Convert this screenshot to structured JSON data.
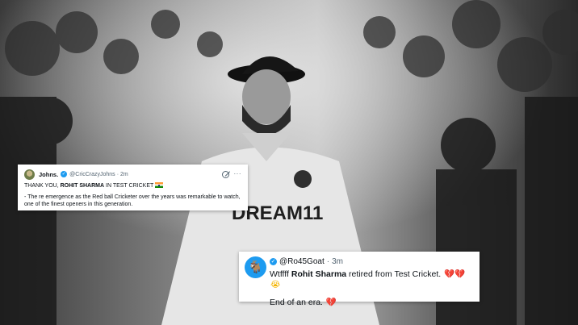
{
  "tweet_top": {
    "name": "Johns.",
    "handle": "@CricCrazyJohns",
    "separator": "·",
    "time": "2m",
    "more_icon": "more-horizontal-icon",
    "lead": "THANK YOU, ",
    "highlight": "ROHIT SHARMA",
    "tail": " IN TEST CRICKET",
    "flag": "india-flag-emoji",
    "body": "- The re emergence as the Red ball Cricketer over the years was remarkable to watch, one of the finest openers in this generation."
  },
  "tweet_bottom": {
    "avatar": "goat-avatar-icon",
    "handle": "@Ro45Goat",
    "separator": "·",
    "time": "3m",
    "lead": "Wtffff ",
    "highlight": "Rohit Sharma",
    "tail": " retired from Test Cricket.",
    "emojis": "💔💔",
    "emoji_cry": "😭",
    "line2": "End of an era.",
    "line2_emoji": "💔"
  },
  "colors": {
    "verified": "#1d9bf0",
    "text": "#0f1419",
    "muted": "#536471",
    "photo_tone": "grayscale"
  },
  "photo": {
    "jersey_text": "DREAM11"
  }
}
